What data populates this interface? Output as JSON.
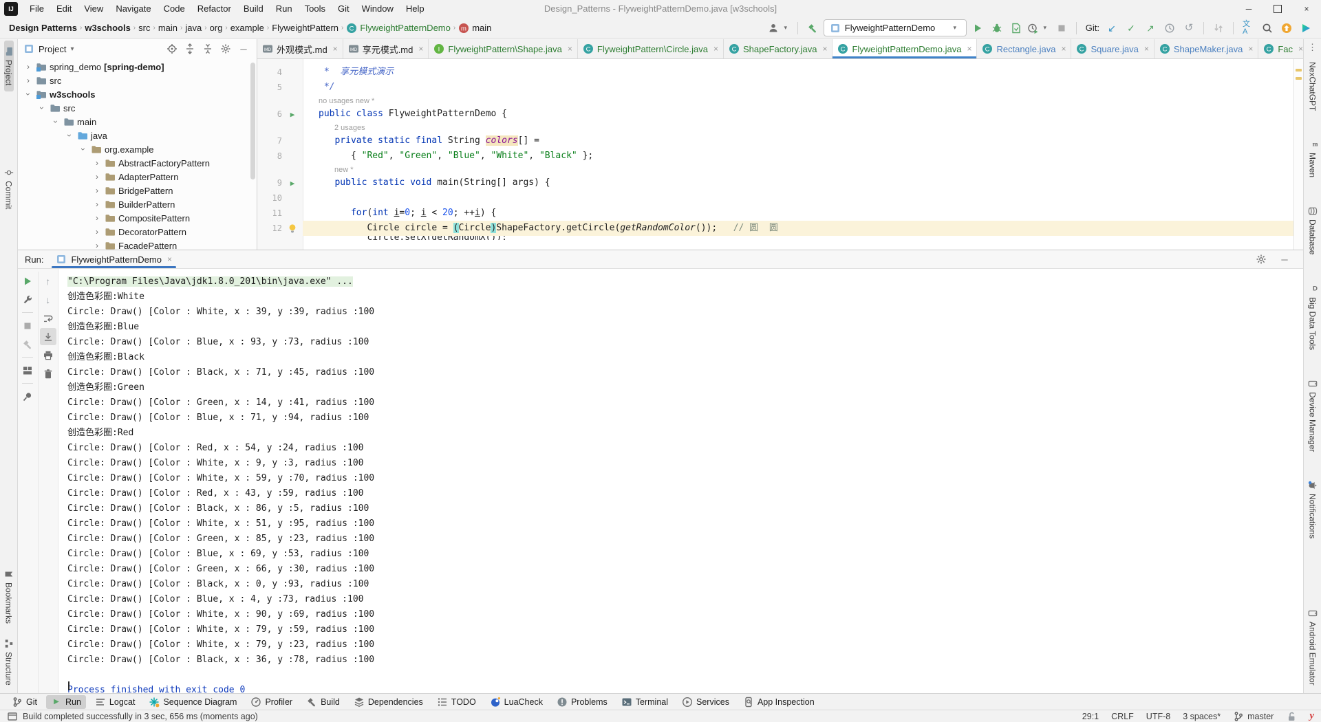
{
  "window": {
    "title": "Design_Patterns - FlyweightPatternDemo.java [w3schools]",
    "menus": [
      "File",
      "Edit",
      "View",
      "Navigate",
      "Code",
      "Refactor",
      "Build",
      "Run",
      "Tools",
      "Git",
      "Window",
      "Help"
    ]
  },
  "breadcrumbs": {
    "items": [
      {
        "label": "Design Patterns",
        "bold": true
      },
      {
        "label": "w3schools",
        "bold": true
      },
      {
        "label": "src"
      },
      {
        "label": "main"
      },
      {
        "label": "java"
      },
      {
        "label": "org"
      },
      {
        "label": "example"
      },
      {
        "label": "FlyweightPattern"
      },
      {
        "label": "FlyweightPatternDemo",
        "icon": "class",
        "green": true
      },
      {
        "label": "main",
        "icon": "method"
      }
    ]
  },
  "toolbar": {
    "run_config": "FlyweightPatternDemo",
    "git_label": "Git:"
  },
  "left_stripe": {
    "top": [
      {
        "label": "Project",
        "icon": "folder",
        "selected": true
      },
      {
        "label": "Commit",
        "icon": "commit"
      }
    ],
    "bottom": [
      {
        "label": "Bookmarks",
        "icon": "bookmark"
      },
      {
        "label": "Structure",
        "icon": "structure"
      }
    ]
  },
  "right_stripe": {
    "top": [
      {
        "label": "NexChatGPT",
        "icon": "none"
      },
      {
        "label": "Maven",
        "icon": "maven"
      },
      {
        "label": "Database",
        "icon": "database"
      },
      {
        "label": "Big Data Tools",
        "icon": "bigdata"
      },
      {
        "label": "Device Manager",
        "icon": "phone"
      },
      {
        "label": "Notifications",
        "icon": "bell"
      }
    ],
    "bottom": [
      {
        "label": "Android Emulator",
        "icon": "phone"
      }
    ]
  },
  "project": {
    "header_title": "Project",
    "tree": [
      {
        "label": "spring_demo",
        "suffix": " [spring-demo]",
        "depth": 0,
        "chev": "right",
        "icon": "module"
      },
      {
        "label": "src",
        "depth": 0,
        "chev": "right",
        "icon": "folder"
      },
      {
        "label": "w3schools",
        "depth": 0,
        "chev": "down",
        "icon": "module",
        "bold": true
      },
      {
        "label": "src",
        "depth": 1,
        "chev": "down",
        "icon": "folder"
      },
      {
        "label": "main",
        "depth": 2,
        "chev": "down",
        "icon": "folder"
      },
      {
        "label": "java",
        "depth": 3,
        "chev": "down",
        "icon": "folder-src"
      },
      {
        "label": "org.example",
        "depth": 4,
        "chev": "down",
        "icon": "package"
      },
      {
        "label": "AbstractFactoryPattern",
        "depth": 5,
        "chev": "right",
        "icon": "package"
      },
      {
        "label": "AdapterPattern",
        "depth": 5,
        "chev": "right",
        "icon": "package"
      },
      {
        "label": "BridgePattern",
        "depth": 5,
        "chev": "right",
        "icon": "package"
      },
      {
        "label": "BuilderPattern",
        "depth": 5,
        "chev": "right",
        "icon": "package"
      },
      {
        "label": "CompositePattern",
        "depth": 5,
        "chev": "right",
        "icon": "package"
      },
      {
        "label": "DecoratorPattern",
        "depth": 5,
        "chev": "right",
        "icon": "package"
      },
      {
        "label": "FacadePattern",
        "depth": 5,
        "chev": "right",
        "icon": "package"
      }
    ]
  },
  "editor": {
    "warning_count": "1",
    "tabs": [
      {
        "icon": "md",
        "label": "外观模式.md",
        "color": "default"
      },
      {
        "icon": "md",
        "label": "享元模式.md",
        "color": "default"
      },
      {
        "icon": "interface",
        "label": "FlyweightPattern\\Shape.java",
        "color": "green"
      },
      {
        "icon": "class",
        "label": "FlyweightPattern\\Circle.java",
        "color": "green"
      },
      {
        "icon": "class",
        "label": "ShapeFactory.java",
        "color": "green"
      },
      {
        "icon": "class",
        "label": "FlyweightPatternDemo.java",
        "color": "green",
        "selected": true
      },
      {
        "icon": "class",
        "label": "Rectangle.java",
        "color": "blue"
      },
      {
        "icon": "class",
        "label": "Square.java",
        "color": "blue"
      },
      {
        "icon": "class",
        "label": "ShapeMaker.java",
        "color": "blue"
      },
      {
        "icon": "class",
        "label": "Fac",
        "color": "green"
      }
    ],
    "rows": [
      {
        "type": "code",
        "num": "4",
        "tokens": [
          [
            "doc",
            " *  享元模式演示"
          ]
        ]
      },
      {
        "type": "code",
        "num": "5",
        "tokens": [
          [
            "doc",
            " */"
          ]
        ]
      },
      {
        "type": "inlay",
        "indent": 0,
        "text": "no usages   new *"
      },
      {
        "type": "code",
        "num": "6",
        "marker": "run",
        "tokens": [
          [
            "kw",
            "public"
          ],
          [
            "pl",
            " "
          ],
          [
            "kw",
            "class"
          ],
          [
            "pl",
            " FlyweightPatternDemo {"
          ]
        ]
      },
      {
        "type": "inlay",
        "indent": 1,
        "text": "2 usages"
      },
      {
        "type": "code",
        "num": "7",
        "tokens": [
          [
            "pl",
            "   "
          ],
          [
            "kw",
            "private"
          ],
          [
            "pl",
            " "
          ],
          [
            "kw",
            "static"
          ],
          [
            "pl",
            " "
          ],
          [
            "kw",
            "final"
          ],
          [
            "pl",
            " String "
          ],
          [
            "field",
            "colors"
          ],
          [
            "pl",
            "[] ="
          ]
        ]
      },
      {
        "type": "code",
        "num": "8",
        "tokens": [
          [
            "pl",
            "      { "
          ],
          [
            "str",
            "\"Red\""
          ],
          [
            "pl",
            ", "
          ],
          [
            "str",
            "\"Green\""
          ],
          [
            "pl",
            ", "
          ],
          [
            "str",
            "\"Blue\""
          ],
          [
            "pl",
            ", "
          ],
          [
            "str",
            "\"White\""
          ],
          [
            "pl",
            ", "
          ],
          [
            "str",
            "\"Black\""
          ],
          [
            "pl",
            " };"
          ]
        ]
      },
      {
        "type": "inlay",
        "indent": 1,
        "text": "new *"
      },
      {
        "type": "code",
        "num": "9",
        "marker": "run",
        "tokens": [
          [
            "pl",
            "   "
          ],
          [
            "kw",
            "public"
          ],
          [
            "pl",
            " "
          ],
          [
            "kw",
            "static"
          ],
          [
            "pl",
            " "
          ],
          [
            "kw",
            "void"
          ],
          [
            "pl",
            " main(String[] args) {"
          ]
        ]
      },
      {
        "type": "code",
        "num": "10",
        "tokens": []
      },
      {
        "type": "code",
        "num": "11",
        "tokens": [
          [
            "pl",
            "      "
          ],
          [
            "kw",
            "for"
          ],
          [
            "pl",
            "("
          ],
          [
            "kw",
            "int"
          ],
          [
            "pl",
            " "
          ],
          [
            "var",
            "i"
          ],
          [
            "pl",
            "="
          ],
          [
            "num2",
            "0"
          ],
          [
            "pl",
            "; "
          ],
          [
            "var",
            "i"
          ],
          [
            "pl",
            " < "
          ],
          [
            "num2",
            "20"
          ],
          [
            "pl",
            "; ++"
          ],
          [
            "var",
            "i"
          ],
          [
            "pl",
            ") {"
          ]
        ]
      },
      {
        "type": "code",
        "num": "12",
        "marker": "bulb",
        "current": true,
        "tokens": [
          [
            "pl",
            "         Circle circle = "
          ],
          [
            "phl",
            "("
          ],
          [
            "pl",
            "Circle"
          ],
          [
            "phl",
            ")"
          ],
          [
            "pl",
            "ShapeFactory.getCircle("
          ],
          [
            "itl",
            "getRandomColor"
          ],
          [
            "pl",
            "());   "
          ],
          [
            "cmt",
            "// 圆  圆"
          ]
        ]
      },
      {
        "type": "code",
        "num": "",
        "clipped": true,
        "tokens": [
          [
            "pl",
            "         circle.setX(getRandomX());"
          ]
        ]
      }
    ]
  },
  "run": {
    "label": "Run:",
    "tab": "FlyweightPatternDemo",
    "console": [
      {
        "cls": "cmd",
        "text": "\"C:\\Program Files\\Java\\jdk1.8.0_201\\bin\\java.exe\" ..."
      },
      {
        "cls": "out",
        "text": "创造色彩圈:White"
      },
      {
        "cls": "out",
        "text": "Circle: Draw() [Color : White, x : 39, y :39, radius :100"
      },
      {
        "cls": "out",
        "text": "创造色彩圈:Blue"
      },
      {
        "cls": "out",
        "text": "Circle: Draw() [Color : Blue, x : 93, y :73, radius :100"
      },
      {
        "cls": "out",
        "text": "创造色彩圈:Black"
      },
      {
        "cls": "out",
        "text": "Circle: Draw() [Color : Black, x : 71, y :45, radius :100"
      },
      {
        "cls": "out",
        "text": "创造色彩圈:Green"
      },
      {
        "cls": "out",
        "text": "Circle: Draw() [Color : Green, x : 14, y :41, radius :100"
      },
      {
        "cls": "out",
        "text": "Circle: Draw() [Color : Blue, x : 71, y :94, radius :100"
      },
      {
        "cls": "out",
        "text": "创造色彩圈:Red"
      },
      {
        "cls": "out",
        "text": "Circle: Draw() [Color : Red, x : 54, y :24, radius :100"
      },
      {
        "cls": "out",
        "text": "Circle: Draw() [Color : White, x : 9, y :3, radius :100"
      },
      {
        "cls": "out",
        "text": "Circle: Draw() [Color : White, x : 59, y :70, radius :100"
      },
      {
        "cls": "out",
        "text": "Circle: Draw() [Color : Red, x : 43, y :59, radius :100"
      },
      {
        "cls": "out",
        "text": "Circle: Draw() [Color : Black, x : 86, y :5, radius :100"
      },
      {
        "cls": "out",
        "text": "Circle: Draw() [Color : White, x : 51, y :95, radius :100"
      },
      {
        "cls": "out",
        "text": "Circle: Draw() [Color : Green, x : 85, y :23, radius :100"
      },
      {
        "cls": "out",
        "text": "Circle: Draw() [Color : Blue, x : 69, y :53, radius :100"
      },
      {
        "cls": "out",
        "text": "Circle: Draw() [Color : Green, x : 66, y :30, radius :100"
      },
      {
        "cls": "out",
        "text": "Circle: Draw() [Color : Black, x : 0, y :93, radius :100"
      },
      {
        "cls": "out",
        "text": "Circle: Draw() [Color : Blue, x : 4, y :73, radius :100"
      },
      {
        "cls": "out",
        "text": "Circle: Draw() [Color : White, x : 90, y :69, radius :100"
      },
      {
        "cls": "out",
        "text": "Circle: Draw() [Color : White, x : 79, y :59, radius :100"
      },
      {
        "cls": "out",
        "text": "Circle: Draw() [Color : White, x : 79, y :23, radius :100"
      },
      {
        "cls": "out",
        "text": "Circle: Draw() [Color : Black, x : 36, y :78, radius :100"
      },
      {
        "cls": "out",
        "text": ""
      },
      {
        "cls": "sys",
        "text": "Process finished with exit code 0"
      }
    ]
  },
  "bottom_bar": {
    "items": [
      {
        "icon": "branch",
        "label": "Git"
      },
      {
        "icon": "play",
        "label": "Run",
        "selected": true
      },
      {
        "icon": "logcat",
        "label": "Logcat"
      },
      {
        "icon": "seq",
        "label": "Sequence Diagram"
      },
      {
        "icon": "profiler",
        "label": "Profiler"
      },
      {
        "icon": "hammer",
        "label": "Build"
      },
      {
        "icon": "deps",
        "label": "Dependencies"
      },
      {
        "icon": "todo",
        "label": "TODO"
      },
      {
        "icon": "lua",
        "label": "LuaCheck"
      },
      {
        "icon": "problems",
        "label": "Problems"
      },
      {
        "icon": "terminal",
        "label": "Terminal"
      },
      {
        "icon": "services",
        "label": "Services"
      },
      {
        "icon": "appinspect",
        "label": "App Inspection"
      }
    ]
  },
  "status_bar": {
    "left": "Build completed successfully in 3 sec, 656 ms (moments ago)",
    "right": [
      {
        "text": "29:1"
      },
      {
        "text": "CRLF"
      },
      {
        "text": "UTF-8"
      },
      {
        "text": "3 spaces*"
      },
      {
        "icon": "branch",
        "text": "master"
      },
      {
        "icon": "lock",
        "text": ""
      }
    ]
  },
  "colors": {
    "accent_blue": "#4083C9",
    "run_green": "#59A869",
    "vcs_added_green": "#2E7D32",
    "vcs_modified_blue": "#4A7FBF",
    "keyword": "#0033B3",
    "string": "#067D17",
    "number": "#1750EB",
    "field": "#871094",
    "current_line": "#FBF3DA",
    "paren_match": "#8FE1DB",
    "warning_yellow": "#F0A732"
  }
}
